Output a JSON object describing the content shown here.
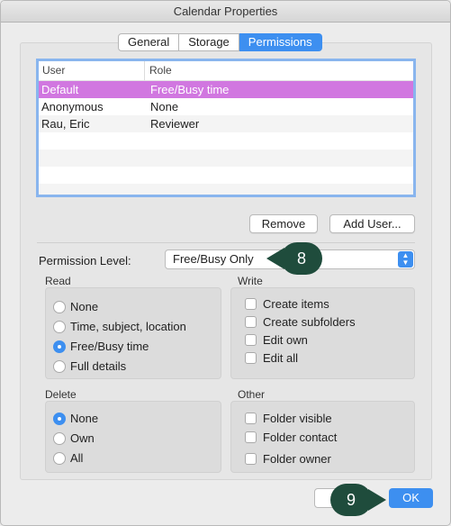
{
  "window": {
    "title": "Calendar Properties"
  },
  "tabs": [
    {
      "label": "General"
    },
    {
      "label": "Storage"
    },
    {
      "label": "Permissions"
    }
  ],
  "table": {
    "headers": {
      "user": "User",
      "role": "Role"
    },
    "rows": [
      {
        "user": "Default",
        "role": "Free/Busy time"
      },
      {
        "user": "Anonymous",
        "role": "None"
      },
      {
        "user": "Rau, Eric",
        "role": "Reviewer"
      }
    ]
  },
  "buttons": {
    "remove": "Remove",
    "add_user": "Add User...",
    "ok": "OK"
  },
  "permission": {
    "label": "Permission Level:",
    "value": "Free/Busy Only"
  },
  "read": {
    "label": "Read",
    "options": [
      "None",
      "Time, subject, location",
      "Free/Busy time",
      "Full details"
    ],
    "selected": "Free/Busy time"
  },
  "write": {
    "label": "Write",
    "options": [
      "Create items",
      "Create subfolders",
      "Edit own",
      "Edit all"
    ]
  },
  "delete": {
    "label": "Delete",
    "options": [
      "None",
      "Own",
      "All"
    ],
    "selected": "None"
  },
  "other": {
    "label": "Other",
    "options": [
      "Folder visible",
      "Folder contact",
      "Folder owner"
    ]
  },
  "callouts": {
    "step8": "8",
    "step9": "9"
  },
  "colors": {
    "accent": "#3d8ff0",
    "selection": "#d177e0",
    "callout": "#1f4c3c"
  }
}
